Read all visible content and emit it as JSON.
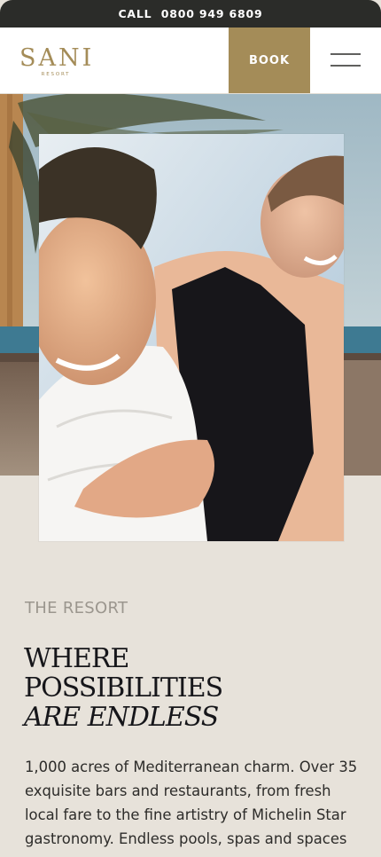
{
  "topbar": {
    "call_label": "CALL",
    "phone": "0800 949 6809"
  },
  "header": {
    "logo_main": "SANI",
    "logo_sub": "RESORT",
    "book_label": "BOOK",
    "menu_icon": "hamburger-icon"
  },
  "colors": {
    "accent": "#a48c58",
    "topbar": "#2b2c29",
    "background": "#e7e2da"
  },
  "section": {
    "label": "THE RESORT",
    "headline_line1": "WHERE",
    "headline_line2": "POSSIBILITIES",
    "headline_line3": "ARE ENDLESS",
    "body": "1,000 acres of Mediterranean charm. Over 35 exquisite bars and restaurants, from fresh local fare to the fine artistry of Michelin Star gastronomy. Endless pools, spas and spaces to"
  }
}
